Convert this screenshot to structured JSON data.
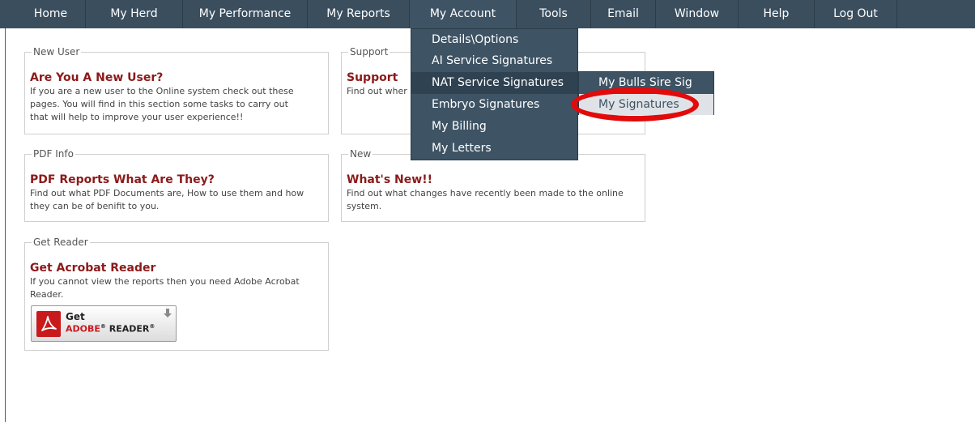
{
  "menubar": {
    "items": [
      {
        "label": "Home"
      },
      {
        "label": "My Herd"
      },
      {
        "label": "My Performance"
      },
      {
        "label": "My Reports"
      },
      {
        "label": "My Account"
      },
      {
        "label": "Tools"
      },
      {
        "label": "Email"
      },
      {
        "label": "Window"
      },
      {
        "label": "Help"
      },
      {
        "label": "Log Out"
      }
    ],
    "active": "My Account"
  },
  "dropdown": {
    "items": [
      {
        "label": "Details\\Options"
      },
      {
        "label": "AI Service Signatures"
      },
      {
        "label": "NAT Service Signatures"
      },
      {
        "label": "Embryo Signatures"
      },
      {
        "label": "My Billing"
      },
      {
        "label": "My Letters"
      }
    ],
    "submenu": [
      {
        "label": "My Bulls Sire Sig"
      },
      {
        "label": "My Signatures"
      }
    ],
    "highlighted": "My Signatures"
  },
  "boxes": {
    "new_user": {
      "legend": "New User",
      "title": "Are You A New User?",
      "line1": "If you are a new user to the Online system check out these",
      "line2": "pages. You will find in this section some tasks to carry out",
      "line3": "that will help to improve your user experience!!"
    },
    "support": {
      "legend": "Support",
      "title": "Support",
      "line1": "Find out wher"
    },
    "pdf_info": {
      "legend": "PDF Info",
      "title": "PDF Reports What Are They?",
      "line1": "Find out what PDF Documents are, How to use them and how",
      "line2": "they can be of benifit to you."
    },
    "new": {
      "legend": "New",
      "title": "What's New!!",
      "line1": "Find out what changes have recently been made to the online",
      "line2": "system."
    },
    "get_reader": {
      "legend": "Get Reader",
      "title": "Get Acrobat Reader",
      "line1": "If you cannot view the reports then you need Adobe Acrobat",
      "line2": "Reader.",
      "badge": {
        "get": "Get",
        "adobe": "ADOBE",
        "reg": "®",
        "reader": " READER",
        "reader_reg": "®"
      }
    }
  },
  "colors": {
    "menubar_bg": "#3a4e5e",
    "dropdown_bg": "#3e5364",
    "title_red": "#8b1a1a",
    "annotation_red": "#e20a0a"
  }
}
